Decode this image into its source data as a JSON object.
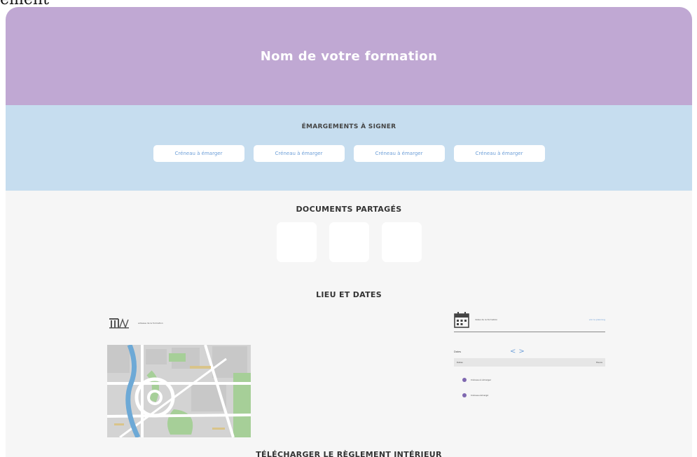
{
  "page_fragment": "ément",
  "hero": {
    "title": "Nom de votre formation"
  },
  "signatures": {
    "title": "ÉMARGEMENTS À SIGNER",
    "slots": [
      "Créneau à émarger",
      "Créneau à émarger",
      "Créneau à émarger",
      "Créneau à émarger"
    ]
  },
  "documents": {
    "title": "DOCUMENTS PARTAGÉS",
    "count": 3
  },
  "location": {
    "title": "LIEU ET DATES",
    "venue_name": "adresse de la formation",
    "icons": {
      "venue": "building-icon",
      "calendar": "calendar-icon",
      "map": "map-image"
    },
    "colors": {
      "park": "#a6cf98",
      "water": "#6da9d6",
      "road": "#ffffff",
      "block": "#d3d3d3"
    }
  },
  "calendar": {
    "header_text": "dates de la formation",
    "link": "voir le planning",
    "month": "Dates",
    "prev_label": "<",
    "next_label": ">",
    "row_left": "Dates",
    "row_right": "Heure",
    "legend": [
      "Créneau à émarger",
      "Créneau émargé"
    ],
    "colors": {
      "accent": "#6fa0d8",
      "legend_dot": "#7f68b0"
    }
  },
  "footer_heading": "TÉLÉCHARGER LE RÈGLEMENT INTÉRIEUR"
}
